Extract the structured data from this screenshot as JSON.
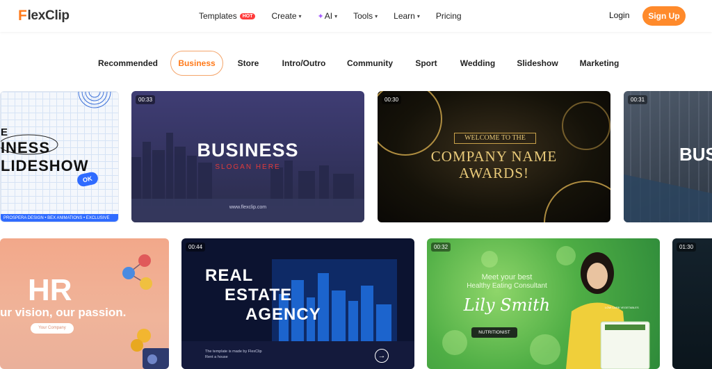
{
  "brand": {
    "name": "lexClip",
    "initial": "F"
  },
  "nav": {
    "templates": "Templates",
    "hot": "HOT",
    "create": "Create",
    "ai": "AI",
    "tools": "Tools",
    "learn": "Learn",
    "pricing": "Pricing",
    "login": "Login",
    "signup": "Sign Up"
  },
  "categories": [
    "Recommended",
    "Business",
    "Store",
    "Intro/Outro",
    "Community",
    "Sport",
    "Wedding",
    "Slideshow",
    "Marketing"
  ],
  "active_category": "Business",
  "cards": {
    "c1": {
      "line1": "E",
      "line2": "INESS",
      "line3": "LIDESHOW",
      "badge": "OK",
      "footer": "PROSPERA DESIGN • BEX ANIMATIONS • EXCLUSIVE"
    },
    "c2": {
      "duration": "00:33",
      "title": "BUSINESS",
      "slogan": "SLOGAN HERE",
      "url": "www.flexclip.com"
    },
    "c3": {
      "duration": "00:30",
      "welcome": "WELCOME TO THE",
      "line1": "COMPANY NAME",
      "line2": "AWARDS!"
    },
    "c4": {
      "duration": "00:31",
      "title": "BUSI"
    },
    "c5": {
      "title": "HR",
      "tagline": "ur vision, our passion.",
      "button": "Your Company"
    },
    "c6": {
      "duration": "00:44",
      "line1": "REAL",
      "line2": "ESTATE",
      "line3": "AGENCY",
      "note1": "The template is made by FlexClip",
      "note2": "Rent a house"
    },
    "c7": {
      "duration": "00:32",
      "line1": "Meet your best",
      "line2": "Healthy Eating Consultant",
      "name": "Lily Smith",
      "role": "NUTRITIONIST",
      "poster": "LOW CARB VEGETABLES"
    },
    "c8": {
      "duration": "01:30"
    }
  },
  "colors": {
    "accent": "#ff7a1a",
    "signup": "#ff8a2b",
    "hot": "#ff3b3b"
  }
}
